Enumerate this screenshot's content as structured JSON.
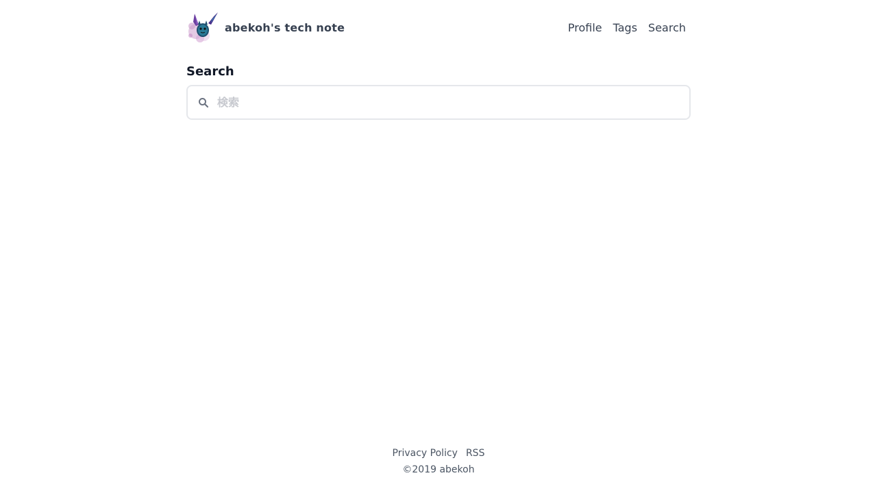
{
  "header": {
    "site_title": "abekoh's tech note",
    "nav": [
      {
        "label": "Profile"
      },
      {
        "label": "Tags"
      },
      {
        "label": "Search"
      }
    ]
  },
  "main": {
    "page_title": "Search",
    "search": {
      "placeholder": "検索",
      "value": "",
      "icon": "search-icon"
    }
  },
  "footer": {
    "links": [
      {
        "label": "Privacy Policy"
      },
      {
        "label": "RSS"
      }
    ],
    "copyright": "©2019 abekoh"
  },
  "colors": {
    "text": "#374151",
    "heading": "#111827",
    "border": "#e5e7eb",
    "placeholder": "#c7c9cf",
    "background": "#ffffff"
  }
}
